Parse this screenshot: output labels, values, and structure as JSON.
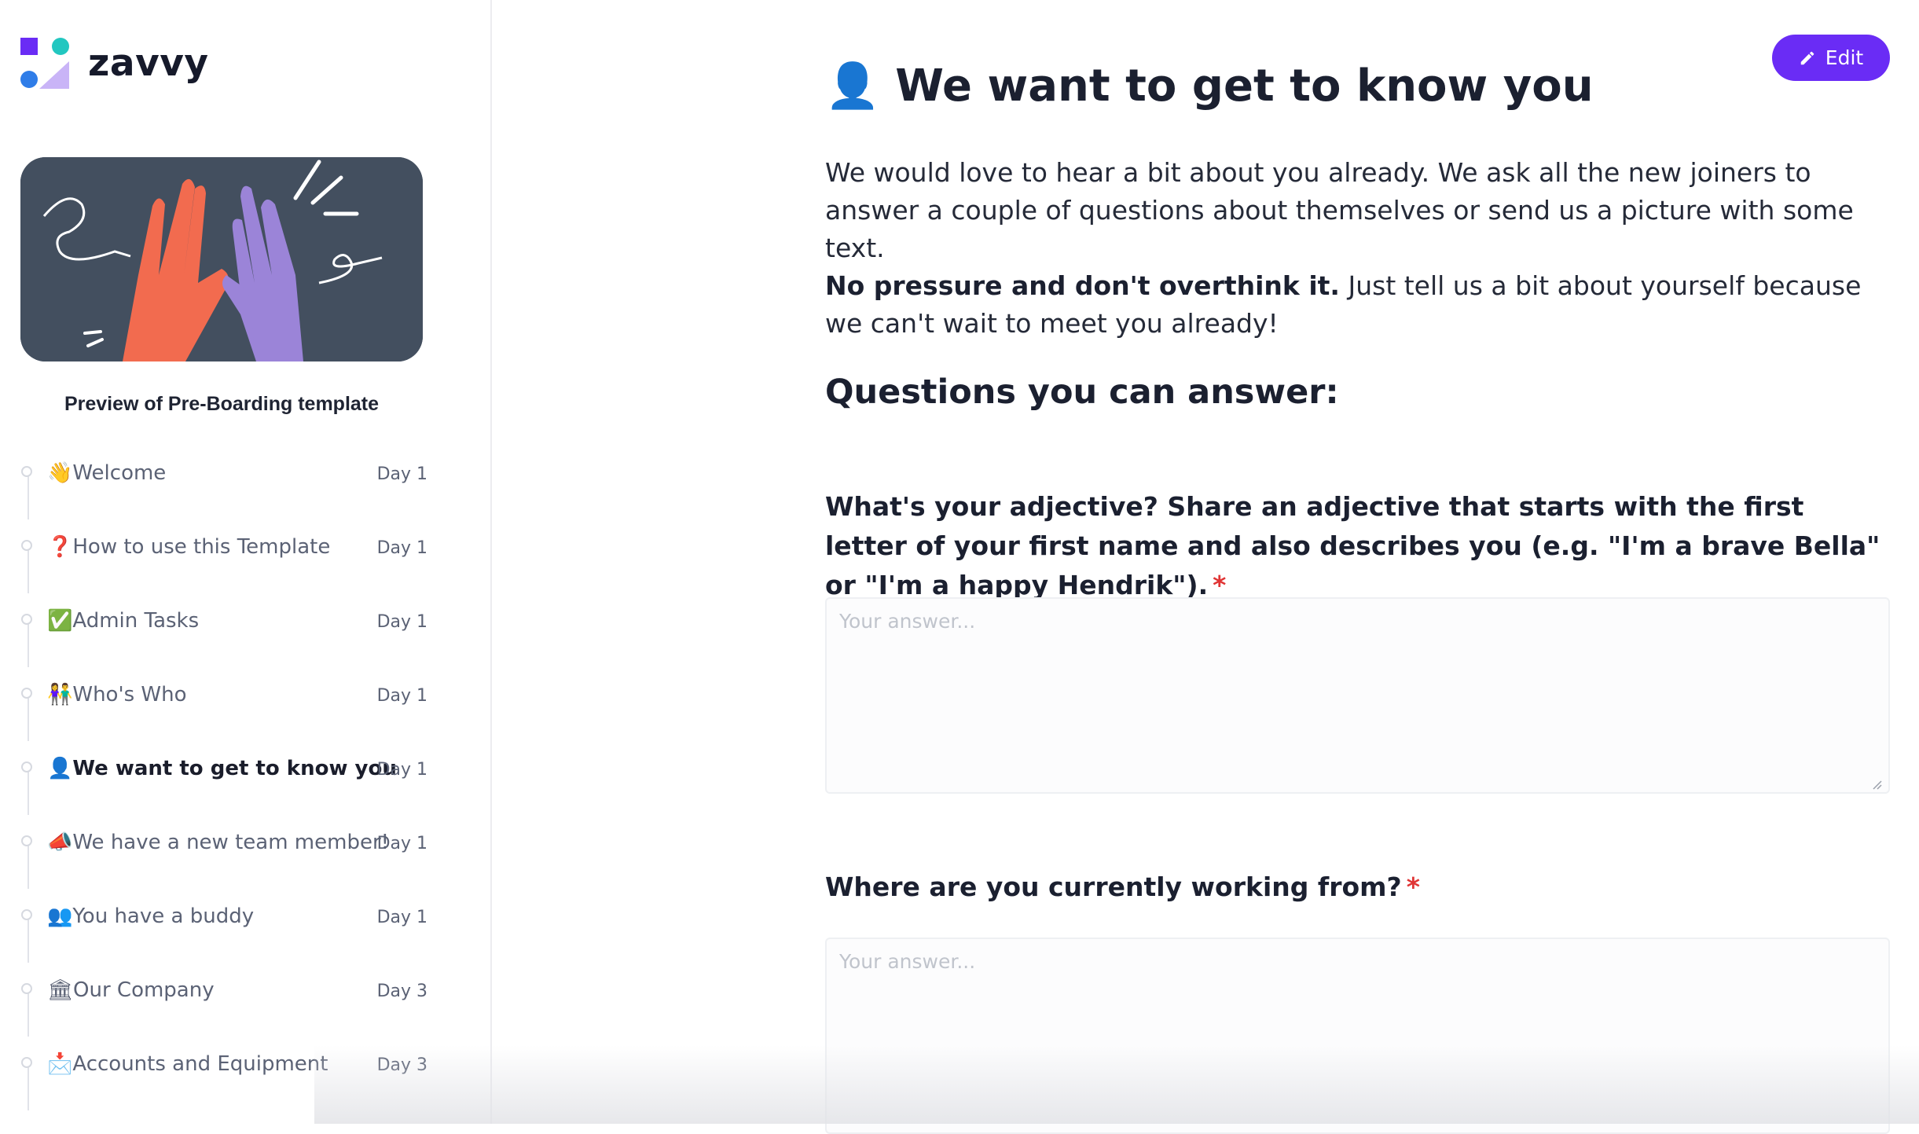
{
  "brand": {
    "name": "zavvy"
  },
  "sidebar": {
    "preview_title": "Preview of Pre-Boarding template",
    "steps": [
      {
        "emoji": "👋",
        "label": "Welcome",
        "day": "Day 1"
      },
      {
        "emoji": "❓",
        "label": "How to use this Template",
        "day": "Day 1"
      },
      {
        "emoji": "✅",
        "label": "Admin Tasks",
        "day": "Day 1"
      },
      {
        "emoji": "👫",
        "label": "Who's Who",
        "day": "Day 1"
      },
      {
        "emoji": "👤",
        "label": "We want to get to know you",
        "day": "Day 1",
        "active": true
      },
      {
        "emoji": "📣",
        "label": "We have a new team member!",
        "day": "Day 1"
      },
      {
        "emoji": "👥",
        "label": "You have a buddy",
        "day": "Day 1"
      },
      {
        "emoji": "🏛",
        "label": "Our Company",
        "day": "Day 3"
      },
      {
        "emoji": "📩",
        "label": "Accounts and Equipment",
        "day": "Day 3"
      }
    ]
  },
  "main": {
    "title_emoji": "👤",
    "title": "We want to get to know you",
    "edit_label": "Edit",
    "intro_line1": "We would love to hear a bit about you already. We ask all the new joiners to answer a couple of questions about themselves or send us a picture with some text.",
    "intro_bold": "No pressure and don't overthink it.",
    "intro_rest": " Just tell us a bit about yourself because we can't wait to meet you already!",
    "section_title": "Questions you can answer:",
    "questions": [
      {
        "text": "What's your adjective? Share an adjective that starts with the first letter of your first name and also describes you (e.g. \"I'm a brave Bella\" or \"I'm a happy Hendrik\").",
        "required_mark": "*",
        "placeholder": "Your answer..."
      },
      {
        "text": "Where are you currently working from?",
        "required_mark": "*",
        "placeholder": "Your answer..."
      }
    ]
  },
  "colors": {
    "accent": "#6a2cf5",
    "required": "#e03535",
    "hero_bg": "#434f5f"
  }
}
